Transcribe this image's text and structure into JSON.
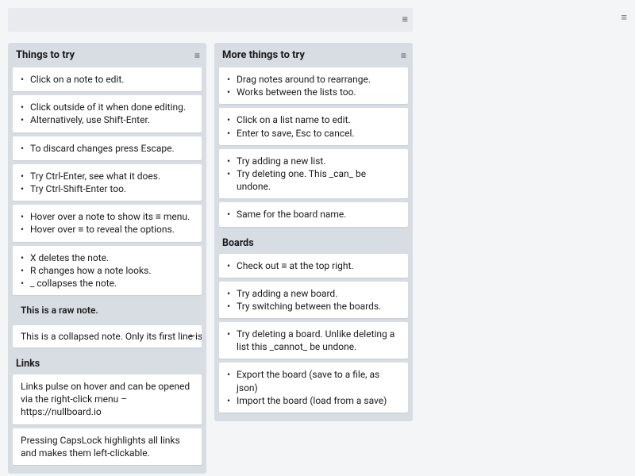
{
  "app": {
    "menu_icon": "menu"
  },
  "board": {
    "menu_icon": "menu"
  },
  "lists": [
    {
      "title": "Things to try",
      "sections": [
        {
          "notes": [
            {
              "type": "bullets",
              "lines": [
                "Click on a note to edit."
              ]
            },
            {
              "type": "bullets",
              "lines": [
                "Click outside of it when done editing.",
                "Alternatively, use Shift-Enter."
              ]
            },
            {
              "type": "bullets",
              "lines": [
                "To discard changes press Escape."
              ]
            },
            {
              "type": "bullets",
              "lines": [
                "Try Ctrl-Enter, see what it does.",
                "Try Ctrl-Shift-Enter too."
              ]
            },
            {
              "type": "bullets",
              "lines": [
                "Hover over a note to show its  ≡  menu.",
                "Hover over  ≡  to reveal the options."
              ]
            },
            {
              "type": "bullets",
              "lines": [
                "X  deletes the note.",
                "R changes how a note looks.",
                "_  collapses the note."
              ]
            },
            {
              "type": "raw",
              "text": "This is a raw note."
            },
            {
              "type": "collapsed",
              "text": "This is a collapsed note. Only its first line is"
            }
          ]
        },
        {
          "heading": "Links",
          "notes": [
            {
              "type": "plain",
              "text": "Links pulse on hover and can be opened via the right-click menu  –  https://nullboard.io"
            },
            {
              "type": "plain",
              "text": "Pressing CapsLock highlights all links and makes them left-clickable."
            }
          ]
        }
      ]
    },
    {
      "title": "More things to try",
      "sections": [
        {
          "notes": [
            {
              "type": "bullets",
              "lines": [
                "Drag notes around to rearrange.",
                "Works between the lists too."
              ]
            },
            {
              "type": "bullets",
              "lines": [
                "Click on a list name to edit.",
                "Enter to save, Esc to cancel."
              ]
            },
            {
              "type": "bullets",
              "lines": [
                "Try adding a new list.",
                "Try deleting one. This  _can_  be undone."
              ]
            },
            {
              "type": "bullets",
              "lines": [
                "Same for the board name."
              ]
            }
          ]
        },
        {
          "heading": "Boards",
          "notes": [
            {
              "type": "bullets",
              "lines": [
                "Check out  ≡  at the top right."
              ]
            },
            {
              "type": "bullets",
              "lines": [
                "Try adding a new board.",
                "Try switching between the boards."
              ]
            },
            {
              "type": "bullets",
              "lines": [
                "Try deleting a board. Unlike deleting a list this  _cannot_  be undone."
              ]
            },
            {
              "type": "bullets",
              "lines": [
                "Export the board  (save to a file, as json)",
                "Import the board  (load from a save)"
              ]
            }
          ]
        }
      ]
    }
  ]
}
